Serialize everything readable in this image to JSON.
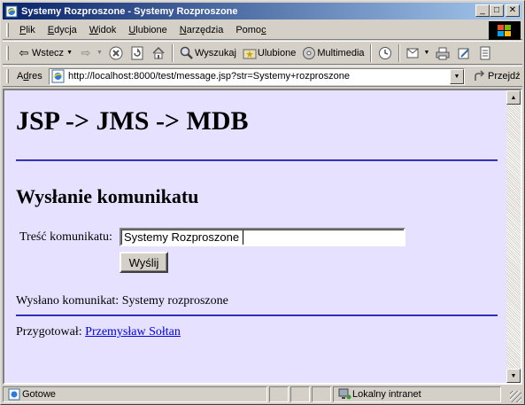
{
  "window": {
    "title": "Systemy Rozproszone - Systemy Rozproszone",
    "minimize": "_",
    "maximize": "□",
    "close": "✕"
  },
  "menu": {
    "items": [
      {
        "accel": "P",
        "rest": "lik"
      },
      {
        "accel": "E",
        "rest": "dycja"
      },
      {
        "accel": "W",
        "rest": "idok"
      },
      {
        "accel": "U",
        "rest": "lubione"
      },
      {
        "accel": "N",
        "rest": "arzędzia"
      },
      {
        "pre": "Pomo",
        "accel": "c",
        "rest": ""
      }
    ]
  },
  "toolbar": {
    "back": "Wstecz",
    "search": "Wyszukaj",
    "favorites": "Ulubione",
    "multimedia": "Multimedia"
  },
  "address": {
    "label": "Adres",
    "accel": "d",
    "url": "http://localhost:8000/test/message.jsp?str=Systemy+rozproszone",
    "go": "Przejdź"
  },
  "page": {
    "heading": "JSP -> JMS -> MDB",
    "subheading": "Wysłanie komunikatu",
    "form_label": "Treść komunikatu:",
    "input_value": "Systemy Rozproszone",
    "submit": "Wyślij",
    "sent_message": "Wysłano komunikat: Systemy rozproszone",
    "author_prefix": "Przygotował:",
    "author_link": "Przemysław Sołtan"
  },
  "status": {
    "text": "Gotowe",
    "zone": "Lokalny intranet"
  },
  "colors": {
    "page_bg": "#e6e1ff",
    "rule": "#0000a0",
    "link": "#0000ee",
    "titlebar_start": "#0a246a",
    "titlebar_end": "#a6caf0"
  }
}
